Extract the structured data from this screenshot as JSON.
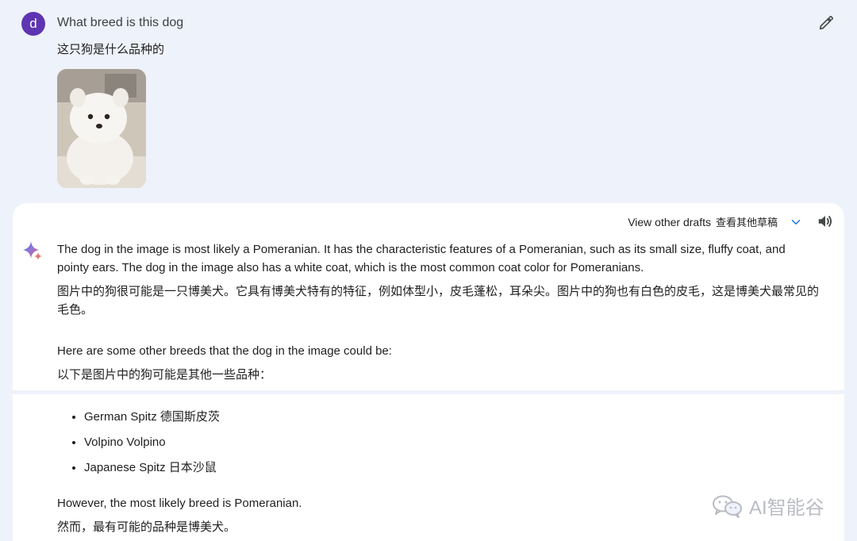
{
  "user": {
    "avatar_letter": "d",
    "prompt_en": "What breed is this dog",
    "prompt_zh": "这只狗是什么品种的"
  },
  "response": {
    "view_drafts_en": "View other drafts",
    "view_drafts_zh": "查看其他草稿",
    "paragraphs": {
      "p1": "The dog in the image is most likely a Pomeranian. It has the characteristic features of a Pomeranian, such as its small size, fluffy coat, and pointy ears. The dog in the image also has a white coat, which is the most common coat color for Pomeranians.",
      "p2": "图片中的狗很可能是一只博美犬。它具有博美犬特有的特征，例如体型小，皮毛蓬松，耳朵尖。图片中的狗也有白色的皮毛，这是博美犬最常见的毛色。",
      "p3": "Here are some other breeds that the dog in the image could be:",
      "p4": "以下是图片中的狗可能是其他一些品种：",
      "p5": "However, the most likely breed is Pomeranian.",
      "p6": "然而，最有可能的品种是博美犬。"
    },
    "breeds": [
      "German Spitz 德国斯皮茨",
      "Volpino Volpino",
      "Japanese Spitz 日本沙鼠"
    ]
  },
  "watermark": {
    "text": "AI智能谷",
    "logo": "wechat-icon"
  },
  "colors": {
    "page_bg": "#eef2fa",
    "card_bg": "#ffffff",
    "avatar_bg": "#5e35b1",
    "accent_blue": "#1a73e8"
  },
  "icons": [
    "edit-icon",
    "chevron-down-icon",
    "speaker-icon",
    "gemini-spark-icon"
  ]
}
